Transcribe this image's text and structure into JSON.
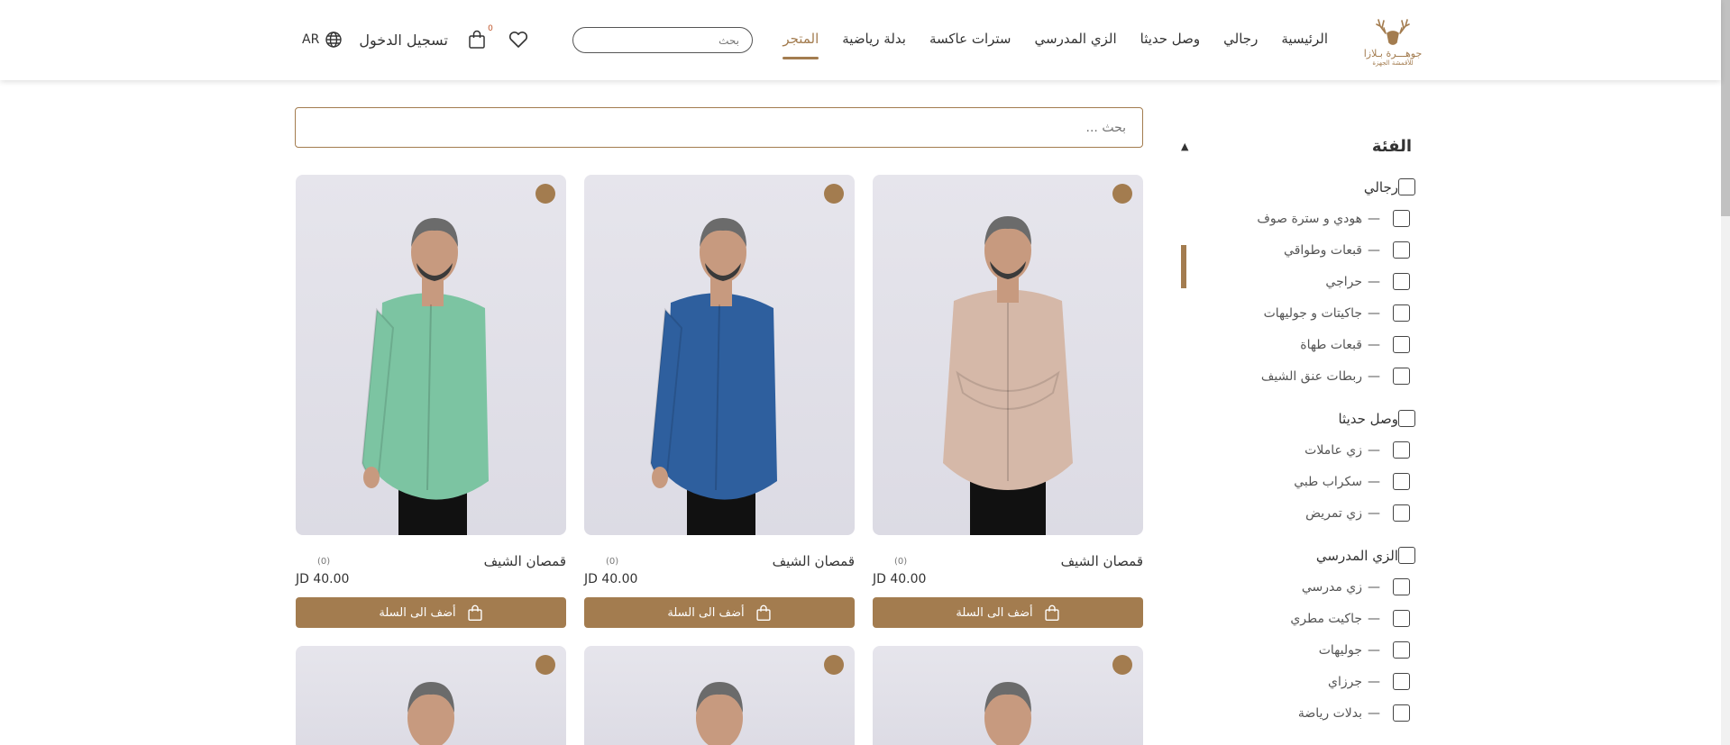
{
  "header": {
    "logo_text": "جوهـــرة بـلازا",
    "logo_sub": "للأقمشة الجهزة",
    "nav": [
      {
        "label": "الرئيسية",
        "active": false
      },
      {
        "label": "رجالي",
        "active": false
      },
      {
        "label": "وصل حديثا",
        "active": false
      },
      {
        "label": "الزي المدرسي",
        "active": false
      },
      {
        "label": "سترات عاكسة",
        "active": false
      },
      {
        "label": "بدلة رياضية",
        "active": false
      },
      {
        "label": "المتجر",
        "active": true
      }
    ],
    "search_placeholder": "بحث",
    "login_label": "تسجيل الدخول",
    "lang_label": "AR",
    "cart_count": "0",
    "icons": {
      "heart": "heart-icon",
      "cart": "shopping-bag-icon",
      "globe": "globe-icon"
    }
  },
  "sidebar": {
    "title": "الفئة",
    "toggle": "▲",
    "groups": [
      {
        "label": "رجالي",
        "children": [
          "هودي و سترة صوف",
          "قبعات وطواقي",
          "حراجي",
          "جاكيتات و جوليهات",
          "قبعات طهاة",
          "ربطات عنق الشيف"
        ]
      },
      {
        "label": "وصل حديثا",
        "children": [
          "زي عاملات",
          "سكراب طبي",
          "زي تمريض"
        ]
      },
      {
        "label": "الزي المدرسي",
        "children": [
          "زي مدرسي",
          "جاكيت مطري",
          "جوليهات",
          "جرزاي",
          "بدلات رياضة"
        ]
      }
    ],
    "child_prefix": "— "
  },
  "products": {
    "search_placeholder": "بحث ...",
    "add_label": "أضف الى السلة",
    "items": [
      {
        "title": "قمصان الشيف",
        "rating": "(0)",
        "price": "JD 40.00",
        "shirt_color": "#d5b8a8",
        "pose": "front"
      },
      {
        "title": "قمصان الشيف",
        "rating": "(0)",
        "price": "JD 40.00",
        "shirt_color": "#2e5f9e",
        "pose": "side"
      },
      {
        "title": "قمصان الشيف",
        "rating": "(0)",
        "price": "JD 40.00",
        "shirt_color": "#7cc4a2",
        "pose": "side"
      }
    ],
    "colors": {
      "accent": "#a37c4f",
      "card_bg": "#e4e3ea"
    }
  }
}
